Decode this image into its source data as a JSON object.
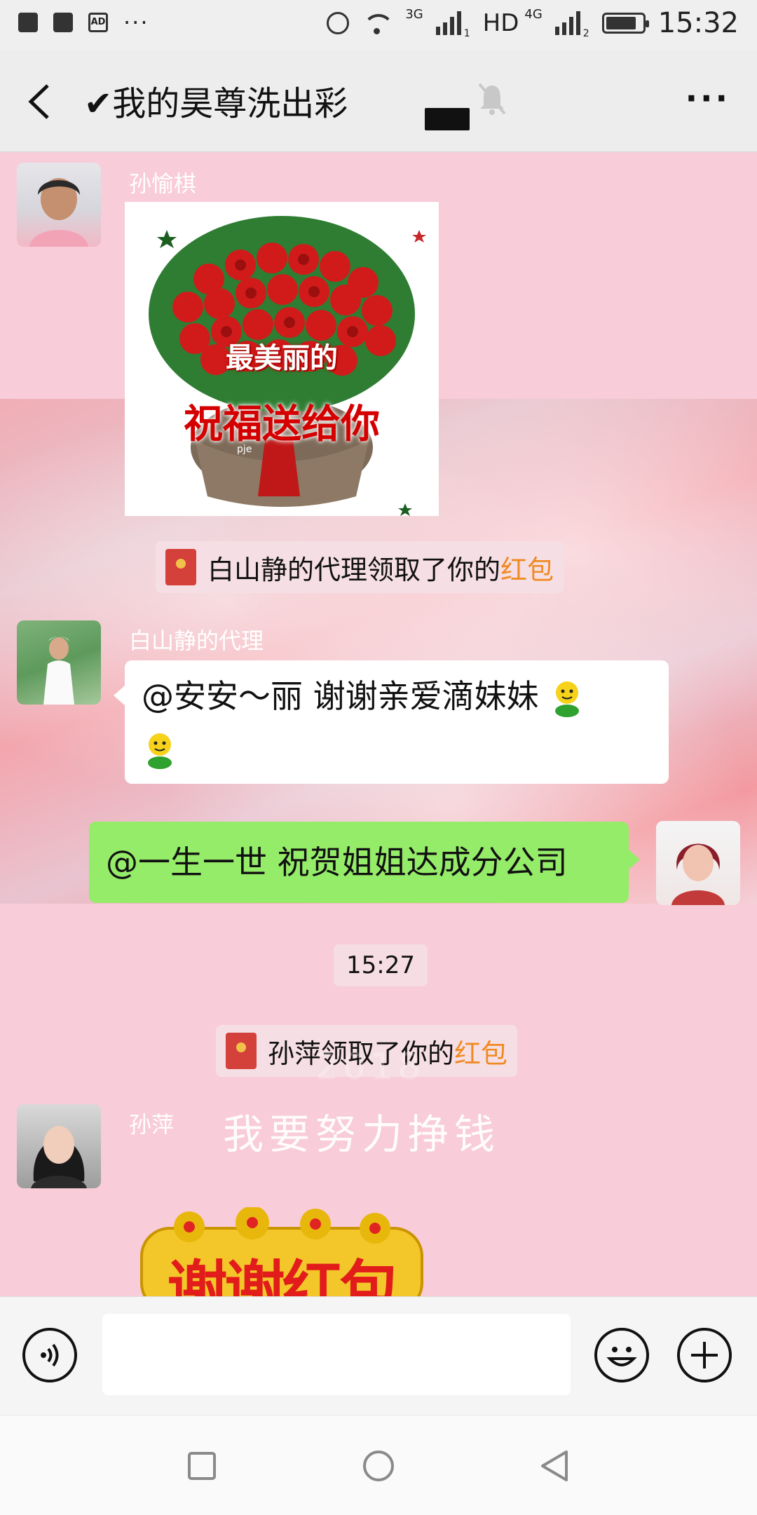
{
  "status_bar": {
    "time": "15:32",
    "ad_badge": "AD",
    "more_dots": "···",
    "net1": "3G",
    "hd": "HD",
    "net2": "4G",
    "sim1": "1",
    "sim2": "2"
  },
  "header": {
    "title": "✔我的昊尊洗出彩",
    "back_glyph": "‹",
    "more_glyph": "···"
  },
  "messages": {
    "m1_sender": "孙愉棋",
    "m1_sticker_line1": "最美丽的",
    "m1_sticker_line2": "祝福送给你",
    "m1_sticker_mark": "pje",
    "notice1_prefix": "白山静的代理领取了你的",
    "notice1_link": "红包",
    "m2_sender": "白山静的代理",
    "m2_text": "@安安～丽  谢谢亲爱滴妹妹",
    "m3_text": "@一生一世  祝贺姐姐达成分公司",
    "time_chip": "15:27",
    "notice2_prefix": "孙萍领取了你的",
    "notice2_link": "红包",
    "m4_sender": "孙萍",
    "m4_bg_year": "2018",
    "m4_bg_text": "我要努力挣钱",
    "m4_sticker_text": "谢谢红包"
  },
  "colors": {
    "chat_bg": "#f8ccd8",
    "bubble_green": "#95ec69",
    "red_packet_word": "#f08a24",
    "red_packet_icon": "#d4403a"
  },
  "icons": [
    "back-arrow-icon",
    "mute-bell-icon",
    "more-icon",
    "voice-icon",
    "emoji-icon",
    "plus-icon",
    "recent-apps-icon",
    "home-icon",
    "back-nav-icon"
  ]
}
